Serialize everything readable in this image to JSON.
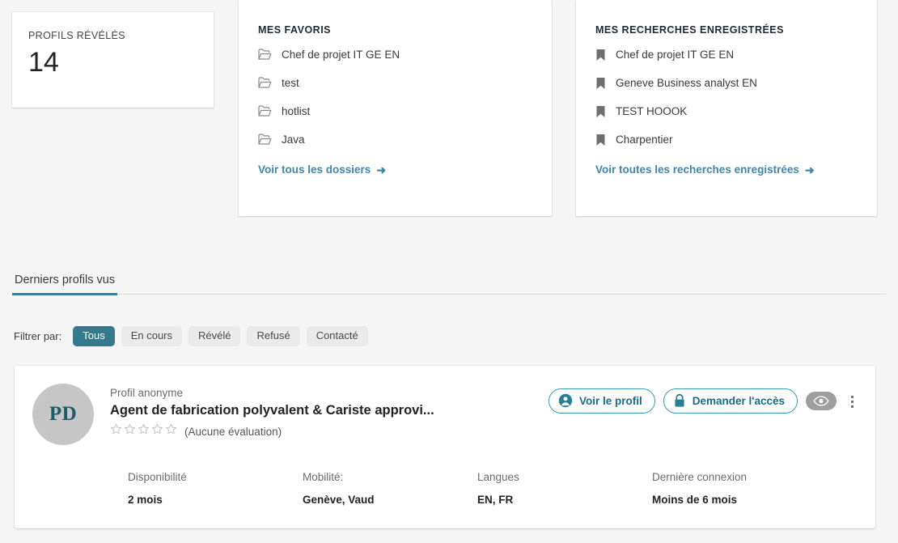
{
  "revealed_tile": {
    "label": "PROFILS RÉVÉLÉS",
    "value": "14"
  },
  "favorites_card": {
    "title": "MES FAVORIS",
    "items": [
      {
        "icon": "folder-icon",
        "label": "Chef de projet IT GE EN"
      },
      {
        "icon": "folder-icon",
        "label": "test"
      },
      {
        "icon": "folder-icon",
        "label": "hotlist"
      },
      {
        "icon": "folder-icon",
        "label": "Java"
      }
    ],
    "link": "Voir tous les dossiers",
    "link_arrow": "➜"
  },
  "searches_card": {
    "title": "MES RECHERCHES ENREGISTRÉES",
    "items": [
      {
        "icon": "bookmark-icon",
        "label": "Chef de projet IT GE EN"
      },
      {
        "icon": "bookmark-icon",
        "label": "Geneve Business analyst EN"
      },
      {
        "icon": "bookmark-icon",
        "label": "TEST HOOOK"
      },
      {
        "icon": "bookmark-icon",
        "label": "Charpentier"
      }
    ],
    "link": "Voir toutes les recherches enregistrées",
    "link_arrow": "➜"
  },
  "tabs": [
    {
      "label": "Derniers profils vus",
      "active": true
    }
  ],
  "filters": {
    "label": "Filtrer par:",
    "options": [
      {
        "label": "Tous",
        "active": true
      },
      {
        "label": "En cours",
        "active": false
      },
      {
        "label": "Révélé",
        "active": false
      },
      {
        "label": "Refusé",
        "active": false
      },
      {
        "label": "Contacté",
        "active": false
      }
    ]
  },
  "profile": {
    "avatar_initials": "PD",
    "anonymous_label": "Profil anonyme",
    "job_title": "Agent de fabrication polyvalent & Cariste approvi...",
    "rating_stars": 0,
    "rating_text": "(Aucune évaluation)",
    "actions": {
      "view_profile": "Voir le profil",
      "request_access": "Demander l'accès"
    },
    "details": [
      {
        "label": "Disponibilité",
        "value": "2 mois"
      },
      {
        "label": "Mobilité:",
        "value": "Genève, Vaud"
      },
      {
        "label": "Langues",
        "value": "EN, FR"
      },
      {
        "label": "Dernière connexion",
        "value": "Moins de 6 mois"
      }
    ]
  },
  "colors": {
    "accent_teal": "#35798d",
    "link_blue": "#3e87ac",
    "button_border": "#3b9bb5",
    "page_bg": "#f5f5f5"
  }
}
